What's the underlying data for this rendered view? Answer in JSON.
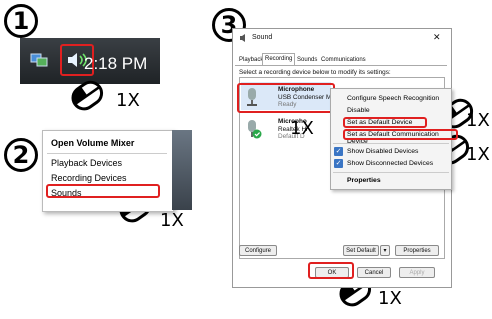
{
  "steps": [
    "1",
    "2",
    "3"
  ],
  "click_labels": {
    "step1": "1X",
    "step2": "1X",
    "set_default": "1X",
    "set_comm_default": "1X",
    "ok": "1X",
    "device_left": "1X"
  },
  "taskbar": {
    "time": "2:18 PM",
    "speaker_icon": "speaker-icon",
    "network_icon": "network-icon"
  },
  "volume_menu": {
    "items": [
      "Open Volume Mixer",
      "Playback Devices",
      "Recording Devices",
      "Sounds"
    ]
  },
  "sound_dialog": {
    "title": "Sound",
    "close": "✕",
    "tabs": [
      "Playback",
      "Recording",
      "Sounds",
      "Communications"
    ],
    "instruction": "Select a recording device below to modify its settings:",
    "devices": [
      {
        "name": "Microphone",
        "desc": "USB Condenser Mi",
        "status": "Ready"
      },
      {
        "name": "Micropho",
        "desc": "Realtek Hi",
        "status": "Default D"
      }
    ],
    "buttons": {
      "configure": "Configure",
      "set_default": "Set Default",
      "properties": "Properties",
      "ok": "OK",
      "cancel": "Cancel",
      "apply": "Apply"
    }
  },
  "device_menu": {
    "items": [
      "Configure Speech Recognition",
      "Disable",
      "Set as Default Device",
      "Set as Default Communication Device",
      "Show Disabled Devices",
      "Show Disconnected Devices",
      "Properties"
    ]
  },
  "colors": {
    "highlight": "#e02020",
    "check": "#3a75c4"
  }
}
